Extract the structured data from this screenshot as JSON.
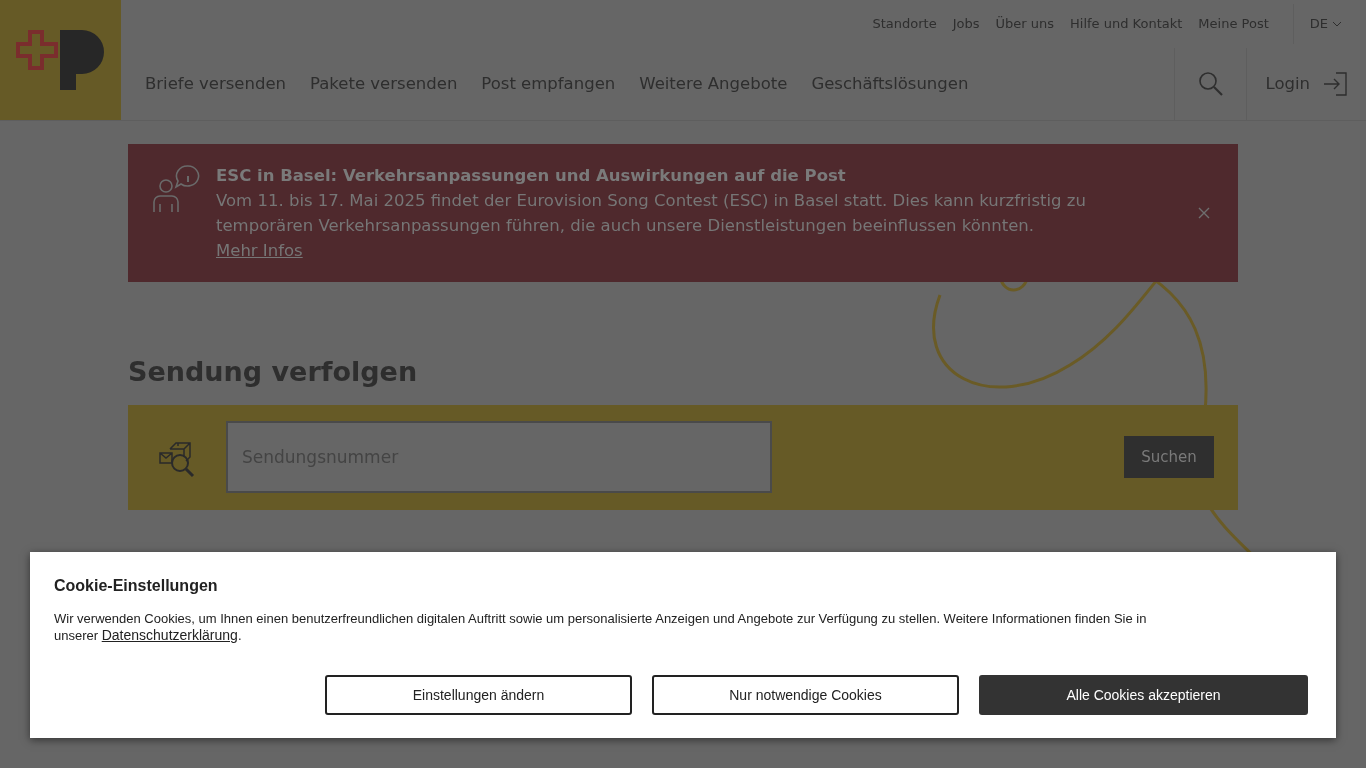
{
  "top_links": [
    "Standorte",
    "Jobs",
    "Über uns",
    "Hilfe und Kontakt",
    "Meine Post"
  ],
  "language": "DE",
  "nav": [
    "Briefe versenden",
    "Pakete versenden",
    "Post empfangen",
    "Weitere Angebote",
    "Geschäftslösungen"
  ],
  "login": "Login",
  "notice": {
    "title": "ESC in Basel: Verkehrsanpassungen und Auswirkungen auf die Post",
    "text": "Vom 11. bis 17. Mai 2025 findet der Eurovision Song Contest (ESC) in Basel statt. Dies kann kurzfristig zu temporären Verkehrsanpassungen führen, die auch unsere Dienstleistungen beeinflussen könnten.",
    "link": "Mehr Infos"
  },
  "tracking": {
    "heading": "Sendung verfolgen",
    "placeholder": "Sendungsnummer",
    "button": "Suchen"
  },
  "cookie": {
    "title": "Cookie-Einstellungen",
    "text": "Wir verwenden Cookies, um Ihnen einen benutzerfreundlichen digitalen Auftritt sowie um personalisierte Anzeigen und Angebote zur Verfügung zu stellen. Weitere Informationen finden Sie in unserer",
    "link": "Datenschutzerklärung",
    "after": ".",
    "buttons": [
      {
        "label": "Einstellungen ändern",
        "kind": "outline"
      },
      {
        "label": "Nur notwendige Cookies",
        "kind": "outline"
      },
      {
        "label": "Alle Cookies akzeptieren",
        "kind": "primary"
      }
    ]
  }
}
